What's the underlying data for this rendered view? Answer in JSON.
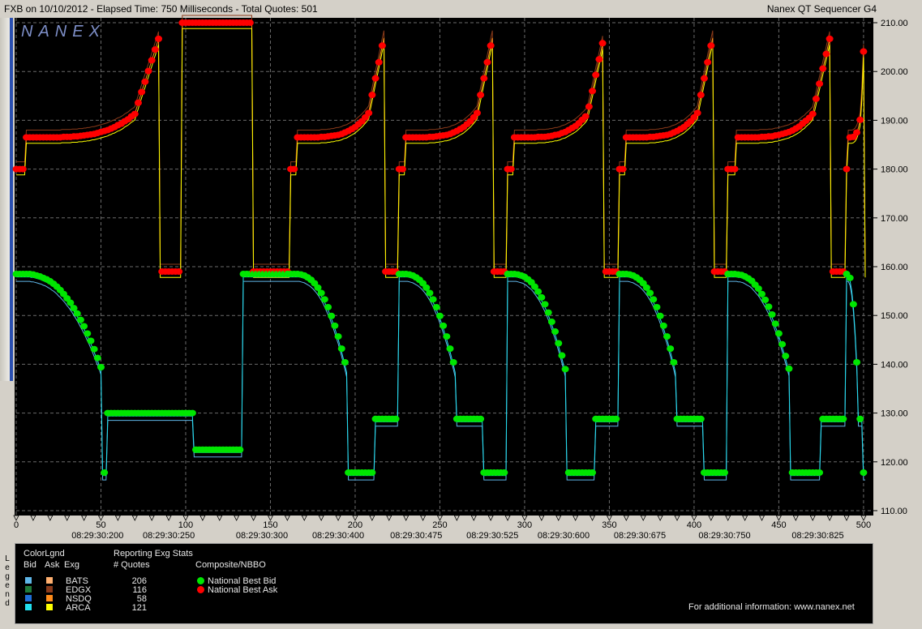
{
  "window": {
    "title_left": "FXB on 10/10/2012  -  Elapsed Time: 750 Milliseconds  -  Total Quotes: 501",
    "title_right": "Nanex QT Sequencer G4"
  },
  "logo": "NANEX",
  "chart_data": {
    "type": "line",
    "xlim": [
      0,
      501
    ],
    "ylim": [
      109,
      211
    ],
    "x_ticks": [
      0,
      50,
      100,
      150,
      200,
      250,
      300,
      350,
      400,
      450,
      500
    ],
    "x_ticks_minor_step": 10,
    "time_labels": [
      {
        "x": 48,
        "label": "08:29:30:200"
      },
      {
        "x": 90,
        "label": "08:29:30:250"
      },
      {
        "x": 145,
        "label": "08:29:30:300"
      },
      {
        "x": 190,
        "label": "08:29:30:400"
      },
      {
        "x": 236,
        "label": "08:29:30:475"
      },
      {
        "x": 281,
        "label": "08:29:30:525"
      },
      {
        "x": 323,
        "label": "08:29:30:600"
      },
      {
        "x": 368,
        "label": "08:29:30:675"
      },
      {
        "x": 418,
        "label": "08:29:30:750"
      },
      {
        "x": 473,
        "label": "08:29:30:825"
      }
    ],
    "y_ticks": [
      110,
      120,
      130,
      140,
      150,
      160,
      170,
      180,
      190,
      200,
      210
    ],
    "grid": true,
    "cycle_starts": [
      0,
      98,
      162,
      226,
      290,
      356,
      420,
      490
    ],
    "series": [
      {
        "name": "National Best Bid",
        "color": "#00e600",
        "marker": "dot"
      },
      {
        "name": "National Best Ask",
        "color": "#ff0000",
        "marker": "dot"
      }
    ]
  },
  "legend": {
    "vertical_label": "Legend",
    "colorlgnd_title": "ColorLgnd",
    "bid_header": "Bid",
    "ask_header": "Ask",
    "exg_header": "Exg",
    "stats_title": "Reporting Exg Stats",
    "quotes_header": "# Quotes",
    "composite_title": "Composite/NBBO",
    "exchanges": [
      {
        "name": "BATS",
        "bid_color": "#5fb6e8",
        "ask_color": "#ffb070",
        "quotes": "206"
      },
      {
        "name": "EDGX",
        "bid_color": "#1f7a3a",
        "ask_color": "#8a3a1a",
        "quotes": "116"
      },
      {
        "name": "NSDQ",
        "bid_color": "#1f6fd8",
        "ask_color": "#ff8c1a",
        "quotes": "58"
      },
      {
        "name": "ARCA",
        "bid_color": "#22e0f0",
        "ask_color": "#ffff00",
        "quotes": "121"
      }
    ],
    "nbbo": [
      {
        "label": "National Best Bid",
        "color": "#00e600"
      },
      {
        "label": "National Best Ask",
        "color": "#ff0000"
      }
    ],
    "footer": "For additional information: www.nanex.net"
  }
}
